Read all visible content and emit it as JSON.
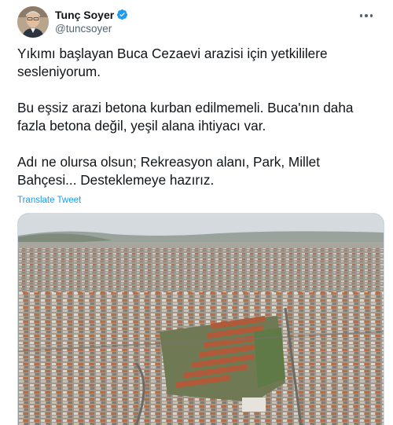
{
  "author": {
    "display_name": "Tunç Soyer",
    "handle": "@tuncsoyer",
    "verified": true
  },
  "tweet": {
    "paragraphs": [
      "Yıkımı başlayan Buca Cezaevi arazisi için yetkililere sesleniyorum.",
      "Bu eşsiz arazi betona kurban edilmemeli. Buca'nın daha fazla betona değil, yeşil alana ihtiyacı var.",
      "Adı ne olursa olsun; Rekreasyon alanı, Park, Millet Bahçesi... Desteklemeye hazırız."
    ],
    "translate_label": "Translate Tweet"
  },
  "icons": {
    "verified": "verified-badge-icon",
    "more": "more-options-icon"
  },
  "colors": {
    "accent": "#1d9bf0",
    "secondary_text": "#536471",
    "primary_text": "#0f1419"
  }
}
